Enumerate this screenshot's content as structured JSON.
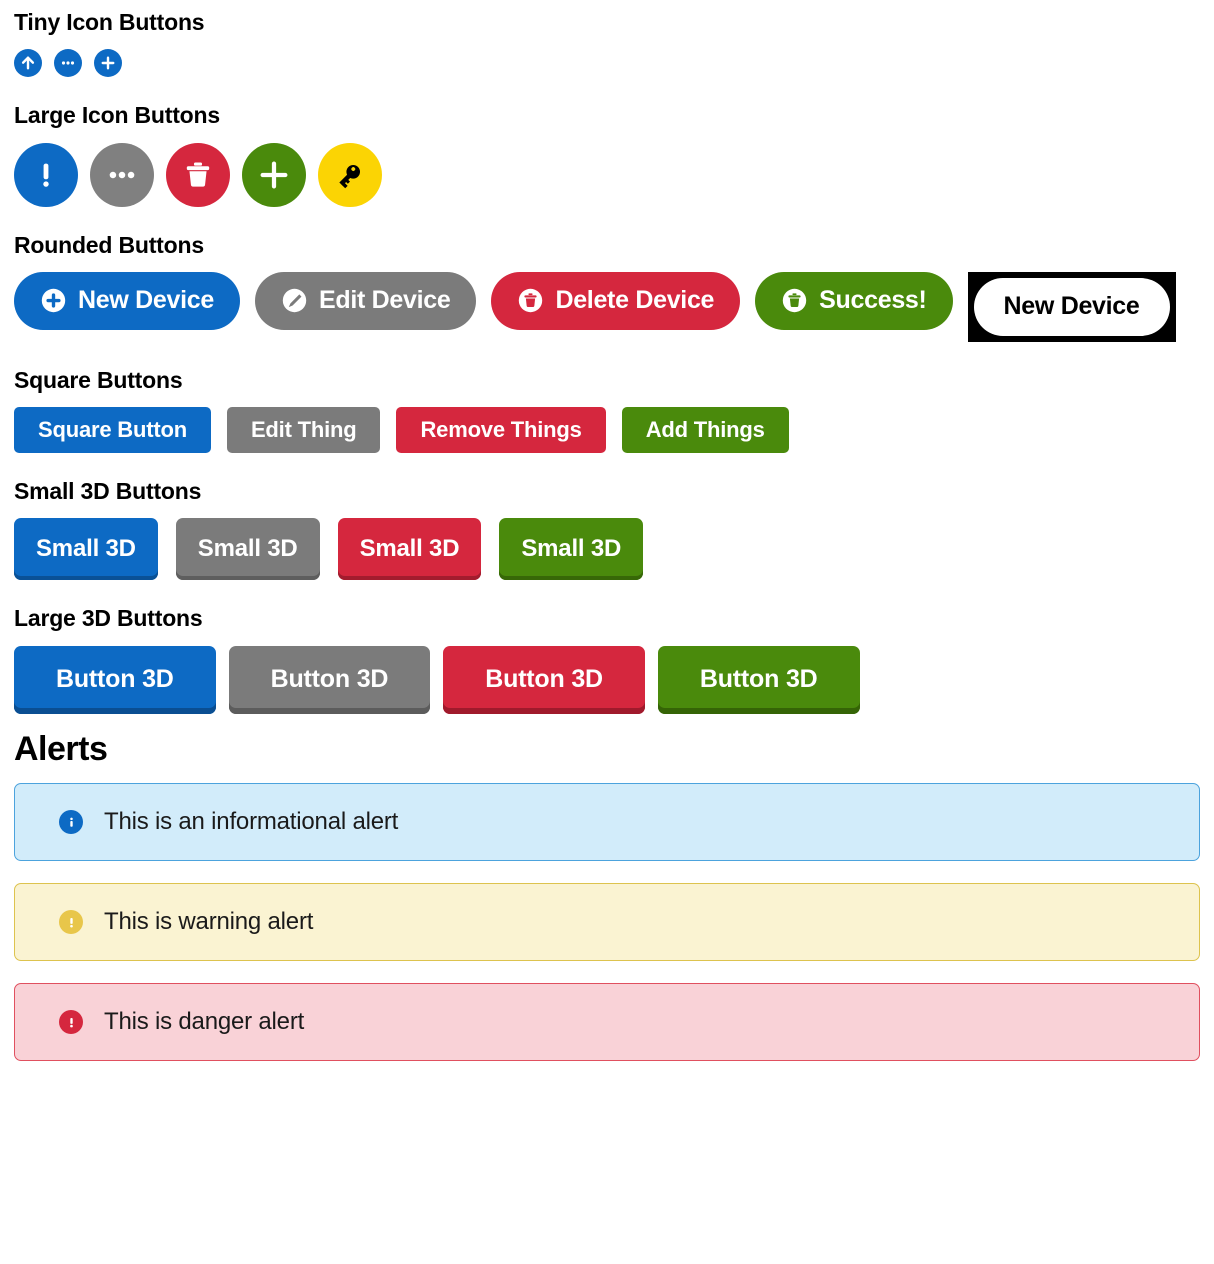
{
  "sections": {
    "tiny_icon_buttons": {
      "label": "Tiny Icon Buttons",
      "buttons": [
        {
          "icon": "arrow-up-icon",
          "color": "#0d6ac4"
        },
        {
          "icon": "ellipsis-icon",
          "color": "#0d6ac4"
        },
        {
          "icon": "plus-icon",
          "color": "#0d6ac4"
        }
      ]
    },
    "large_icon_buttons": {
      "label": "Large Icon Buttons",
      "buttons": [
        {
          "icon": "exclamation-icon",
          "color": "#0d6ac4",
          "glyph_color": "#ffffff"
        },
        {
          "icon": "ellipsis-icon",
          "color": "#808080",
          "glyph_color": "#ffffff"
        },
        {
          "icon": "trash-icon",
          "color": "#d5273e",
          "glyph_color": "#ffffff"
        },
        {
          "icon": "plus-icon",
          "color": "#4a8a0c",
          "glyph_color": "#ffffff"
        },
        {
          "icon": "key-icon",
          "color": "#fbd404",
          "glyph_color": "#000000"
        }
      ]
    },
    "rounded_buttons": {
      "label": "Rounded Buttons",
      "buttons": [
        {
          "label": "New Device",
          "icon": "plus-circle-icon",
          "color": "#0d6ac4",
          "text_color": "#ffffff",
          "style": "solid"
        },
        {
          "label": "Edit Device",
          "icon": "pencil-circle-icon",
          "color": "#7b7b7b",
          "text_color": "#ffffff",
          "style": "solid"
        },
        {
          "label": "Delete Device",
          "icon": "trash-circle-icon",
          "color": "#d5273e",
          "text_color": "#ffffff",
          "style": "solid"
        },
        {
          "label": "Success!",
          "icon": "trash-circle-icon",
          "color": "#4a8a0c",
          "text_color": "#ffffff",
          "style": "solid"
        },
        {
          "label": "New Device",
          "icon": "none",
          "color": "#ffffff",
          "text_color": "#000000",
          "style": "inverse"
        }
      ]
    },
    "square_buttons": {
      "label": "Square Buttons",
      "buttons": [
        {
          "label": "Square Button",
          "color": "#0d6ac4"
        },
        {
          "label": "Edit Thing",
          "color": "#7b7b7b"
        },
        {
          "label": "Remove Things",
          "color": "#d5273e"
        },
        {
          "label": "Add Things",
          "color": "#4a8a0c"
        }
      ]
    },
    "small_3d_buttons": {
      "label": "Small 3D Buttons",
      "buttons": [
        {
          "label": "Small 3D",
          "color": "#0d6ac4",
          "shadow_color": "#0a5196"
        },
        {
          "label": "Small 3D",
          "color": "#7b7b7b",
          "shadow_color": "#5e5e5e"
        },
        {
          "label": "Small 3D",
          "color": "#d5273e",
          "shadow_color": "#a31c2e"
        },
        {
          "label": "Small 3D",
          "color": "#4a8a0c",
          "shadow_color": "#376807"
        }
      ]
    },
    "large_3d_buttons": {
      "label": "Large 3D Buttons",
      "buttons": [
        {
          "label": "Button 3D",
          "color": "#0d6ac4",
          "shadow_color": "#0a4e92"
        },
        {
          "label": "Button 3D",
          "color": "#7b7b7b",
          "shadow_color": "#5c5c5c"
        },
        {
          "label": "Button 3D",
          "color": "#d5273e",
          "shadow_color": "#a01a2c"
        },
        {
          "label": "Button 3D",
          "color": "#4a8a0c",
          "shadow_color": "#356406"
        }
      ]
    },
    "alerts": {
      "heading": "Alerts",
      "items": [
        {
          "icon": "info-icon",
          "text": "This is an informational alert",
          "bg": "#d2ecfa",
          "border": "#4ca3dd",
          "icon_bg": "#0d6ac4",
          "icon_glyph": "i"
        },
        {
          "icon": "warning-icon",
          "text": "This is warning alert",
          "bg": "#faf3d2",
          "border": "#ddc34e",
          "icon_bg": "#e8c64a",
          "icon_glyph": "!"
        },
        {
          "icon": "danger-icon",
          "text": "This is danger alert",
          "bg": "#f9d2d7",
          "border": "#e0505f",
          "icon_bg": "#d5273e",
          "icon_glyph": "!"
        }
      ]
    }
  }
}
